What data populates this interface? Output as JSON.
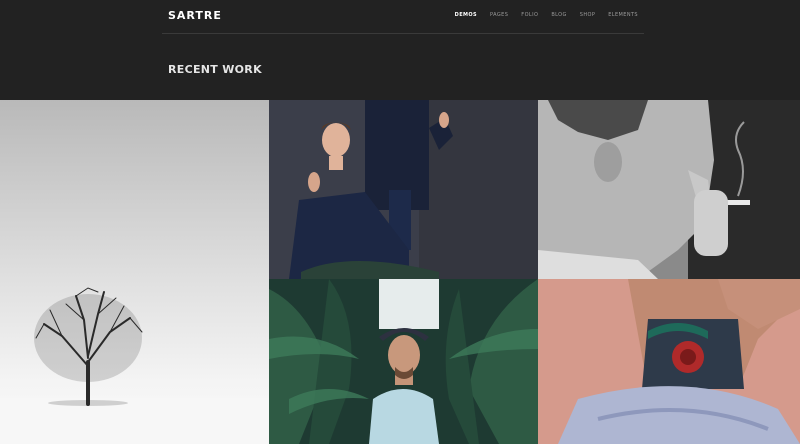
{
  "header": {
    "logo": "SARTRE",
    "nav": [
      {
        "label": "DEMOS",
        "active": true
      },
      {
        "label": "PAGES",
        "active": false
      },
      {
        "label": "FOLIO",
        "active": false
      },
      {
        "label": "BLOG",
        "active": false
      },
      {
        "label": "SHOP",
        "active": false
      },
      {
        "label": "ELEMENTS",
        "active": false
      }
    ]
  },
  "page": {
    "title": "RECENT WORK"
  },
  "colors": {
    "background": "#222222",
    "nav_inactive": "#9a9a9a",
    "nav_active": "#ffffff"
  }
}
